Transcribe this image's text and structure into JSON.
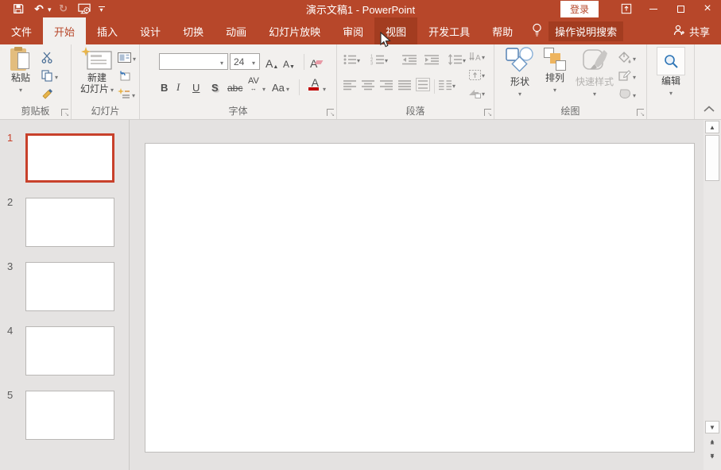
{
  "colors": {
    "accent": "#b7472a",
    "tab_hover": "#a33c20",
    "selected_slide_border": "#c8412b"
  },
  "titlebar": {
    "title": "演示文稿1 - PowerPoint",
    "signin": "登录"
  },
  "tabs": [
    {
      "label": "文件"
    },
    {
      "label": "开始",
      "state": "selected"
    },
    {
      "label": "插入"
    },
    {
      "label": "设计"
    },
    {
      "label": "切换"
    },
    {
      "label": "动画"
    },
    {
      "label": "幻灯片放映"
    },
    {
      "label": "审阅"
    },
    {
      "label": "视图",
      "state": "hover"
    },
    {
      "label": "开发工具"
    },
    {
      "label": "帮助"
    }
  ],
  "tellme": {
    "label": "操作说明搜索"
  },
  "share": {
    "label": "共享"
  },
  "ribbon": {
    "clipboard": {
      "paste": "粘贴",
      "label": "剪贴板"
    },
    "slides": {
      "new_line1": "新建",
      "new_line2": "幻灯片",
      "label": "幻灯片"
    },
    "font": {
      "size": "24",
      "bold": "B",
      "italic": "I",
      "underline": "U",
      "shadow": "S",
      "strike": "abc",
      "spacing": "AV",
      "case_btn": "Aa",
      "color_btn": "A",
      "label": "字体"
    },
    "paragraph": {
      "label": "段落"
    },
    "drawing": {
      "shapes": "形状",
      "arrange": "排列",
      "quick_styles": "快速样式",
      "label": "绘图"
    },
    "editing": {
      "edit": "编辑"
    }
  },
  "slide_panel": {
    "slides": [
      {
        "number": "1"
      },
      {
        "number": "2"
      },
      {
        "number": "3"
      },
      {
        "number": "4"
      },
      {
        "number": "5"
      }
    ],
    "selected_number": "1"
  }
}
